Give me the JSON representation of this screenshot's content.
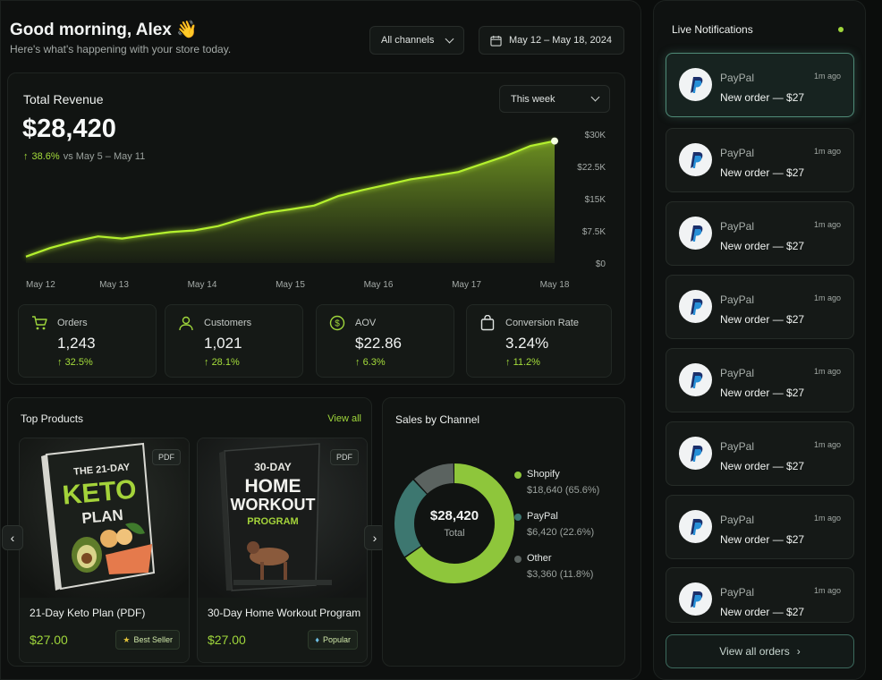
{
  "header": {
    "greeting": "Good morning, Alex 👋",
    "subtitle": "Here's what's happening with your store today.",
    "channel_filter": "All channels",
    "date_range": "May 12 – May 18, 2024"
  },
  "revenue": {
    "title": "Total Revenue",
    "value": "$28,420",
    "change": "38.6%",
    "change_context": "vs May 5 – May 11",
    "period_filter": "This week"
  },
  "chart_data": {
    "type": "area",
    "x": [
      "May 12",
      "May 13",
      "May 14",
      "May 15",
      "May 16",
      "May 17",
      "May 18"
    ],
    "y_ticks": [
      "$30K",
      "$22.5K",
      "$15K",
      "$7.5K",
      "$0"
    ],
    "ylim": [
      0,
      30000
    ],
    "series": [
      {
        "values": [
          1500,
          3500,
          5000,
          6200,
          5700,
          6500,
          7200,
          7600,
          8600,
          10300,
          11700,
          12500,
          13400,
          15600,
          17000,
          18200,
          19500,
          20300,
          21200,
          23100,
          25000,
          27300,
          28420
        ]
      }
    ],
    "accent_color": "#b4f02e"
  },
  "stats": [
    {
      "label": "Orders",
      "value": "1,243",
      "change": "32.5%",
      "icon": "cart-icon"
    },
    {
      "label": "Customers",
      "value": "1,021",
      "change": "28.1%",
      "icon": "user-icon"
    },
    {
      "label": "AOV",
      "value": "$22.86",
      "change": "6.3%",
      "icon": "dollar-icon"
    },
    {
      "label": "Conversion Rate",
      "value": "3.24%",
      "change": "11.2%",
      "icon": "bag-icon"
    }
  ],
  "products": {
    "title": "Top Products",
    "view_all": "View all",
    "items": [
      {
        "name": "21-Day Keto Plan (PDF)",
        "price": "$27.00",
        "badge": "Best Seller",
        "format": "PDF",
        "cover": [
          "THE 21-DAY",
          "KETO",
          "PLAN"
        ]
      },
      {
        "name": "30-Day Home Workout Program",
        "price": "$27.00",
        "badge": "Popular",
        "format": "PDF",
        "cover": [
          "30-DAY",
          "HOME",
          "WORKOUT",
          "PROGRAM"
        ]
      }
    ]
  },
  "channels": {
    "title": "Sales by Channel",
    "center_value": "$28,420",
    "center_label": "Total",
    "items": [
      {
        "name": "Shopify",
        "value": "$18,640 (65.6%)",
        "share": 65.6,
        "color": "#8ec63b"
      },
      {
        "name": "PayPal",
        "value": "$6,420 (22.6%)",
        "share": 22.6,
        "color": "#3d7770"
      },
      {
        "name": "Other",
        "value": "$3,360 (11.8%)",
        "share": 11.8,
        "color": "#5b6360"
      }
    ]
  },
  "notifications": {
    "title": "Live Notifications",
    "items": [
      {
        "source": "PayPal",
        "message": "New order — $27",
        "time": "1m ago"
      },
      {
        "source": "PayPal",
        "message": "New order — $27",
        "time": "1m ago"
      },
      {
        "source": "PayPal",
        "message": "New order — $27",
        "time": "1m ago"
      },
      {
        "source": "PayPal",
        "message": "New order — $27",
        "time": "1m ago"
      },
      {
        "source": "PayPal",
        "message": "New order — $27",
        "time": "1m ago"
      },
      {
        "source": "PayPal",
        "message": "New order — $27",
        "time": "1m ago"
      },
      {
        "source": "PayPal",
        "message": "New order — $27",
        "time": "1m ago"
      },
      {
        "source": "PayPal",
        "message": "New order — $27",
        "time": "1m ago"
      }
    ],
    "view_all": "View all orders"
  }
}
